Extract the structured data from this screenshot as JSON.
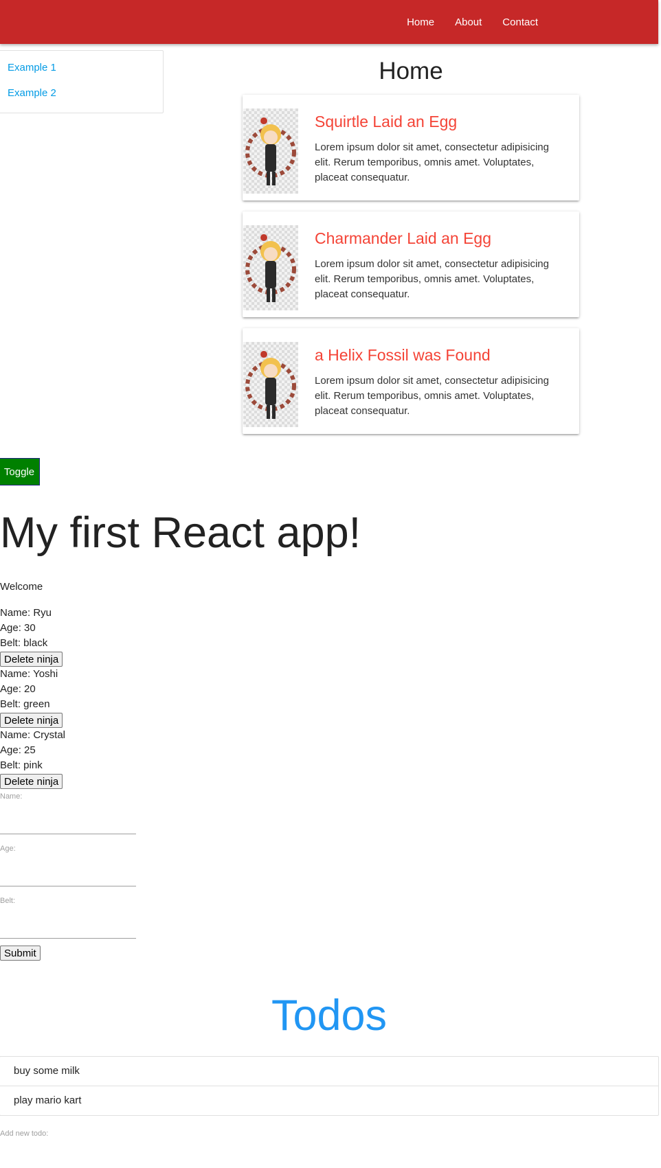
{
  "nav": {
    "links": [
      "Home",
      "About",
      "Contact"
    ],
    "background": "#c62828"
  },
  "sidebar": {
    "items": [
      "Example 1",
      "Example 2"
    ]
  },
  "home": {
    "title": "Home",
    "posts": [
      {
        "title": "Squirtle Laid an Egg",
        "body": "Lorem ipsum dolor sit amet, consectetur adipisicing elit. Rerum temporibus, omnis amet. Voluptates, placeat consequatur."
      },
      {
        "title": "Charmander Laid an Egg",
        "body": "Lorem ipsum dolor sit amet, consectetur adipisicing elit. Rerum temporibus, omnis amet. Voluptates, placeat consequatur."
      },
      {
        "title": "a Helix Fossil was Found",
        "body": "Lorem ipsum dolor sit amet, consectetur adipisicing elit. Rerum temporibus, omnis amet. Voluptates, placeat consequatur."
      }
    ],
    "post_title_color": "#f44336"
  },
  "toggle": {
    "label": "Toggle",
    "color": "#008000"
  },
  "app": {
    "title": "My first React app!",
    "welcome": "Welcome"
  },
  "ninjas": [
    {
      "name": "Name: Ryu",
      "age": "Age: 30",
      "belt": "Belt: black",
      "button": "Delete ninja"
    },
    {
      "name": "Name: Yoshi",
      "age": "Age: 20",
      "belt": "Belt: green",
      "button": "Delete ninja"
    },
    {
      "name": "Name: Crystal",
      "age": "Age: 25",
      "belt": "Belt: pink",
      "button": "Delete ninja"
    }
  ],
  "form": {
    "name_label": "Name:",
    "age_label": "Age:",
    "belt_label": "Belt:",
    "submit_label": "Submit"
  },
  "todos": {
    "title": "Todos",
    "title_color": "#2196f3",
    "items": [
      "buy some milk",
      "play mario kart"
    ],
    "add_label": "Add new todo:"
  },
  "icons": {
    "post_thumbnail": "anime-character-avatar"
  }
}
